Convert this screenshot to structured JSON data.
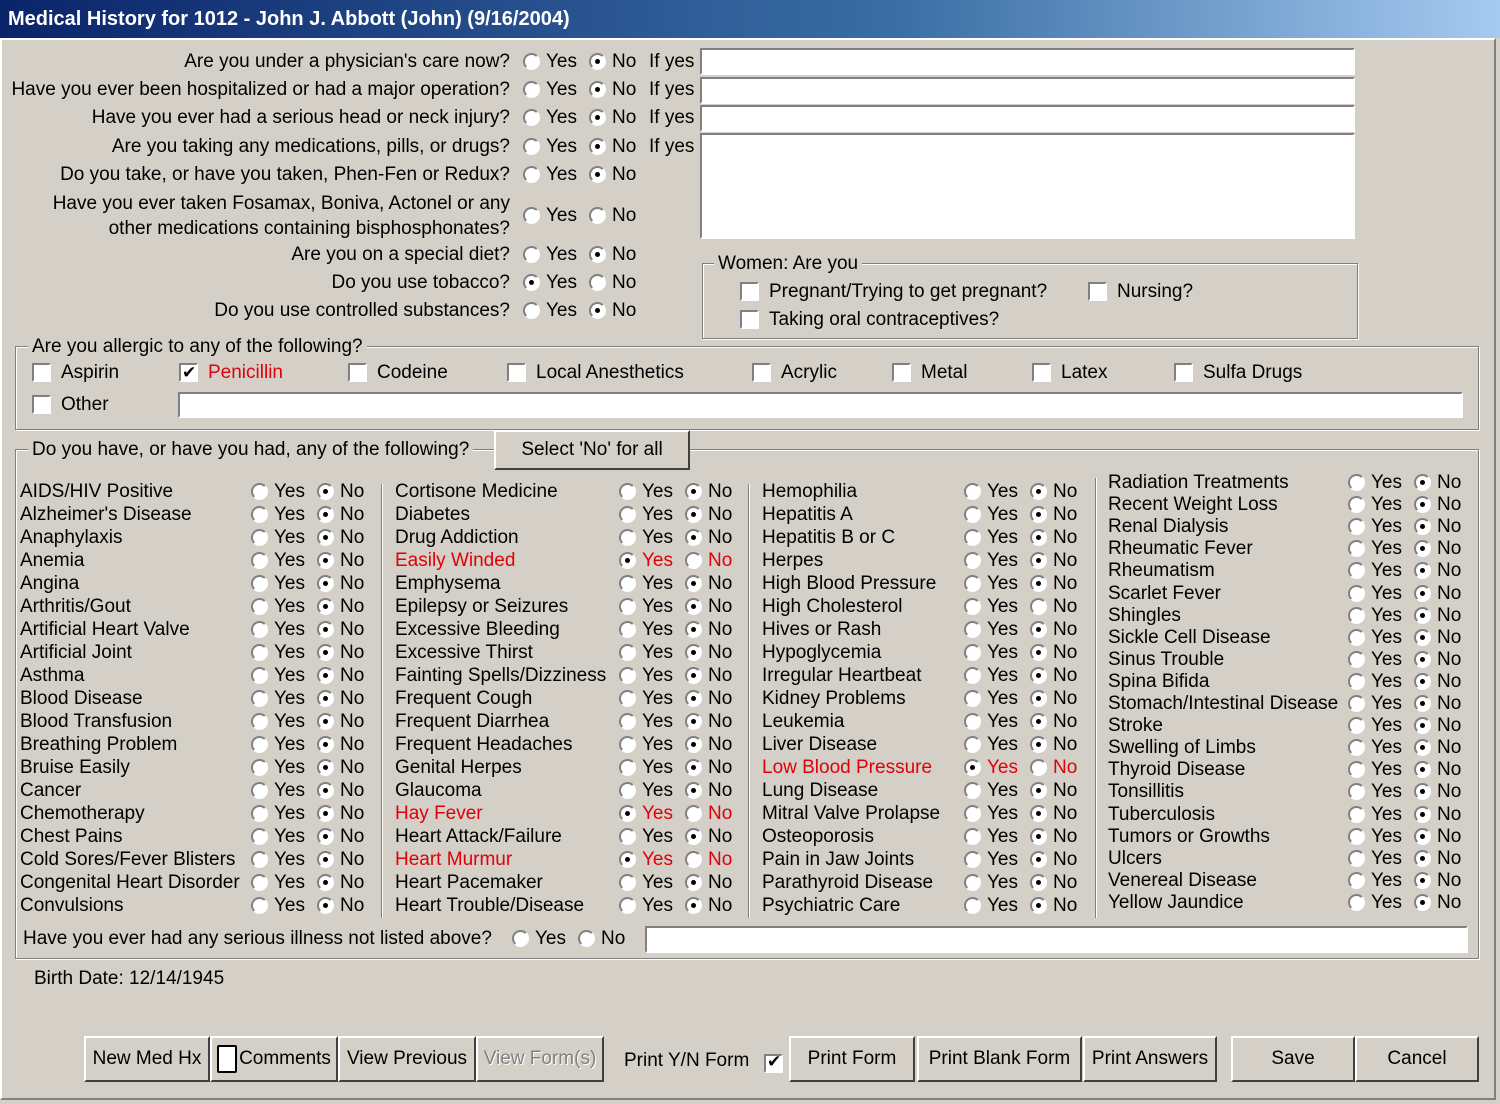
{
  "title": "Medical History for 1012 - John J. Abbott (John) (9/16/2004)",
  "yes_label": "Yes",
  "no_label": "No",
  "if_yes_label": "If yes",
  "questions": [
    {
      "text": "Are you under a physician's care now?",
      "answer": "No",
      "if_yes": true
    },
    {
      "text": "Have you ever been hospitalized or had a major operation?",
      "answer": "No",
      "if_yes": true
    },
    {
      "text": "Have you ever had a serious head or neck injury?",
      "answer": "No",
      "if_yes": true
    },
    {
      "text": "Are you taking any medications, pills, or drugs?",
      "answer": "No",
      "if_yes": true
    },
    {
      "text": "Do you take, or have you taken, Phen-Fen or Redux?",
      "answer": "No",
      "if_yes": false
    },
    {
      "text": "Have you ever taken Fosamax, Boniva, Actonel or any other medications containing bisphosphonates?",
      "text_line1": "Have you ever taken Fosamax, Boniva, Actonel or any",
      "text_line2": "other medications containing bisphosphonates?",
      "answer": "",
      "if_yes": false
    },
    {
      "text": "Are you on a special diet?",
      "answer": "No",
      "if_yes": false
    },
    {
      "text": "Do you use tobacco?",
      "answer": "Yes",
      "if_yes": false
    },
    {
      "text": "Do you use controlled substances?",
      "answer": "No",
      "if_yes": false
    }
  ],
  "women": {
    "legend": "Women: Are you",
    "pregnant": {
      "label": "Pregnant/Trying to get pregnant?",
      "checked": false
    },
    "nursing": {
      "label": "Nursing?",
      "checked": false
    },
    "contraceptives": {
      "label": "Taking oral contraceptives?",
      "checked": false
    }
  },
  "allergies": {
    "legend": "Are you allergic to any of the following?",
    "items": [
      {
        "label": "Aspirin",
        "checked": false
      },
      {
        "label": "Penicillin",
        "checked": true
      },
      {
        "label": "Codeine",
        "checked": false
      },
      {
        "label": "Local Anesthetics",
        "checked": false
      },
      {
        "label": "Acrylic",
        "checked": false
      },
      {
        "label": "Metal",
        "checked": false
      },
      {
        "label": "Latex",
        "checked": false
      },
      {
        "label": "Sulfa Drugs",
        "checked": false
      }
    ],
    "other_label": "Other",
    "other_checked": false,
    "other_value": ""
  },
  "conditions": {
    "legend": "Do you have, or have you had, any of the following?",
    "select_no_label": "Select 'No' for all",
    "columns": [
      [
        {
          "name": "AIDS/HIV Positive",
          "answer": "No"
        },
        {
          "name": "Alzheimer's Disease",
          "answer": "No"
        },
        {
          "name": "Anaphylaxis",
          "answer": "No"
        },
        {
          "name": "Anemia",
          "answer": "No"
        },
        {
          "name": "Angina",
          "answer": "No"
        },
        {
          "name": "Arthritis/Gout",
          "answer": "No"
        },
        {
          "name": "Artificial Heart Valve",
          "answer": "No"
        },
        {
          "name": "Artificial Joint",
          "answer": "No"
        },
        {
          "name": "Asthma",
          "answer": "No"
        },
        {
          "name": "Blood Disease",
          "answer": "No"
        },
        {
          "name": "Blood Transfusion",
          "answer": "No"
        },
        {
          "name": "Breathing Problem",
          "answer": "No"
        },
        {
          "name": "Bruise Easily",
          "answer": "No"
        },
        {
          "name": "Cancer",
          "answer": "No"
        },
        {
          "name": "Chemotherapy",
          "answer": "No"
        },
        {
          "name": "Chest Pains",
          "answer": "No"
        },
        {
          "name": "Cold Sores/Fever Blisters",
          "answer": "No"
        },
        {
          "name": "Congenital Heart Disorder",
          "answer": "No"
        },
        {
          "name": "Convulsions",
          "answer": "No"
        }
      ],
      [
        {
          "name": "Cortisone Medicine",
          "answer": "No"
        },
        {
          "name": "Diabetes",
          "answer": "No"
        },
        {
          "name": "Drug Addiction",
          "answer": "No"
        },
        {
          "name": "Easily Winded",
          "answer": "Yes"
        },
        {
          "name": "Emphysema",
          "answer": "No"
        },
        {
          "name": "Epilepsy or Seizures",
          "answer": "No"
        },
        {
          "name": "Excessive Bleeding",
          "answer": "No"
        },
        {
          "name": "Excessive Thirst",
          "answer": "No"
        },
        {
          "name": "Fainting Spells/Dizziness",
          "answer": "No"
        },
        {
          "name": "Frequent Cough",
          "answer": "No"
        },
        {
          "name": "Frequent Diarrhea",
          "answer": "No"
        },
        {
          "name": "Frequent Headaches",
          "answer": "No"
        },
        {
          "name": "Genital Herpes",
          "answer": "No"
        },
        {
          "name": "Glaucoma",
          "answer": "No"
        },
        {
          "name": "Hay Fever",
          "answer": "Yes"
        },
        {
          "name": "Heart Attack/Failure",
          "answer": "No"
        },
        {
          "name": "Heart Murmur",
          "answer": "Yes"
        },
        {
          "name": "Heart Pacemaker",
          "answer": "No"
        },
        {
          "name": "Heart Trouble/Disease",
          "answer": "No"
        }
      ],
      [
        {
          "name": "Hemophilia",
          "answer": "No"
        },
        {
          "name": "Hepatitis A",
          "answer": "No"
        },
        {
          "name": "Hepatitis B or C",
          "answer": "No"
        },
        {
          "name": "Herpes",
          "answer": "No"
        },
        {
          "name": "High Blood Pressure",
          "answer": "No"
        },
        {
          "name": "High Cholesterol",
          "answer": ""
        },
        {
          "name": "Hives or Rash",
          "answer": "No"
        },
        {
          "name": "Hypoglycemia",
          "answer": "No"
        },
        {
          "name": "Irregular Heartbeat",
          "answer": "No"
        },
        {
          "name": "Kidney Problems",
          "answer": "No"
        },
        {
          "name": "Leukemia",
          "answer": "No"
        },
        {
          "name": "Liver Disease",
          "answer": "No"
        },
        {
          "name": "Low Blood Pressure",
          "answer": "Yes"
        },
        {
          "name": "Lung Disease",
          "answer": "No"
        },
        {
          "name": "Mitral Valve Prolapse",
          "answer": "No"
        },
        {
          "name": "Osteoporosis",
          "answer": "No"
        },
        {
          "name": "Pain in Jaw Joints",
          "answer": "No"
        },
        {
          "name": "Parathyroid Disease",
          "answer": "No"
        },
        {
          "name": "Psychiatric Care",
          "answer": "No"
        }
      ],
      [
        {
          "name": "Radiation Treatments",
          "answer": "No"
        },
        {
          "name": "Recent Weight Loss",
          "answer": "No"
        },
        {
          "name": "Renal Dialysis",
          "answer": "No"
        },
        {
          "name": "Rheumatic Fever",
          "answer": "No"
        },
        {
          "name": "Rheumatism",
          "answer": "No"
        },
        {
          "name": "Scarlet Fever",
          "answer": "No"
        },
        {
          "name": "Shingles",
          "answer": "No"
        },
        {
          "name": "Sickle Cell Disease",
          "answer": "No"
        },
        {
          "name": "Sinus Trouble",
          "answer": "No"
        },
        {
          "name": "Spina Bifida",
          "answer": "No"
        },
        {
          "name": "Stomach/Intestinal Disease",
          "answer": "No"
        },
        {
          "name": "Stroke",
          "answer": "No"
        },
        {
          "name": "Swelling of Limbs",
          "answer": "No"
        },
        {
          "name": "Thyroid Disease",
          "answer": "No"
        },
        {
          "name": "Tonsillitis",
          "answer": "No"
        },
        {
          "name": "Tuberculosis",
          "answer": "No"
        },
        {
          "name": "Tumors or Growths",
          "answer": "No"
        },
        {
          "name": "Ulcers",
          "answer": "No"
        },
        {
          "name": "Venereal Disease",
          "answer": "No"
        },
        {
          "name": "Yellow Jaundice",
          "answer": "No"
        }
      ]
    ],
    "serious_illness_label": "Have you ever had any serious illness not listed above?",
    "serious_illness_answer": "",
    "serious_illness_value": ""
  },
  "birth_date": "Birth Date: 12/14/1945",
  "buttons": {
    "new_med_hx": "New Med Hx",
    "comments": "Comments",
    "view_previous": "View Previous",
    "view_forms": "View Form(s)",
    "print_yn_label": "Print Y/N Form",
    "print_yn_checked": true,
    "print_form": "Print Form",
    "print_blank_form": "Print Blank Form",
    "print_answers": "Print Answers",
    "save": "Save",
    "cancel": "Cancel"
  },
  "colors": {
    "highlight": "#e0000a",
    "dialog_bg": "#d4d0c8",
    "title_bar": "#0a246a"
  },
  "icons": {
    "comments": "clipboard-icon",
    "checkmark": "checkmark-icon"
  }
}
